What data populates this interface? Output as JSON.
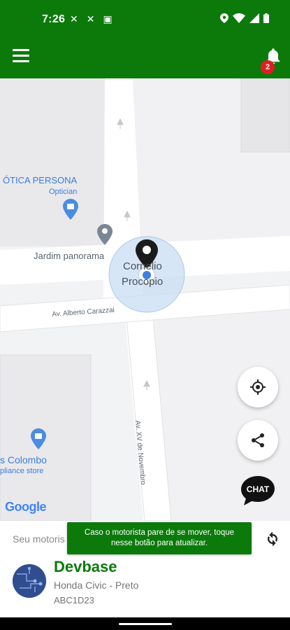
{
  "status_bar": {
    "time": "7:26",
    "left_icons": [
      "✕",
      "✕",
      "▣"
    ]
  },
  "app_bar": {
    "menu_icon": "hamburger-icon",
    "notification_icon": "bell-icon",
    "notification_count": "2"
  },
  "map": {
    "labels": {
      "optician_name": "ÓTICA PERSONA",
      "optician_type": "Optician",
      "park_name": "Jardim panorama",
      "place_name_line1": "Cornelio",
      "place_name_line2": "Procopio",
      "street_1": "Av. Alberto Carazzai",
      "street_2": "Av. XV de Novembro",
      "store_name": "s Colombo",
      "store_type": "pliance store",
      "brand": "Google"
    }
  },
  "actions": {
    "locate_icon": "crosshair-icon",
    "share_icon": "share-icon",
    "chat_label": "CHAT"
  },
  "bottom_sheet": {
    "driver_label": "Seu motoris",
    "tooltip": "Caso o motorista pare de se mover, toque nesse botão para atualizar.",
    "driver_name": "Devbase",
    "car_model": "Honda Civic - Preto",
    "plate": "ABC1D23"
  },
  "colors": {
    "brand_green": "#0b7a0b",
    "badge_red": "#e11d24",
    "poi_blue": "#3b7ddd"
  }
}
